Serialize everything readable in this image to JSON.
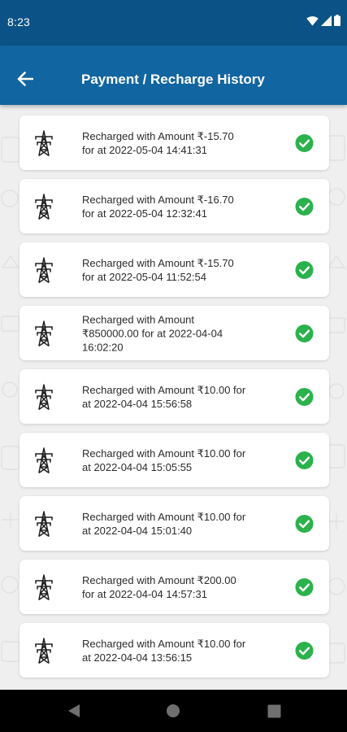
{
  "status_bar": {
    "time": "8:23",
    "icons": [
      "wifi-icon",
      "signal-icon",
      "battery-icon"
    ]
  },
  "app_bar": {
    "title": "Payment / Recharge History",
    "back_icon": "arrow-left-icon"
  },
  "history": [
    {
      "line1": "Recharged with Amount ₹-15.70",
      "line2": "for  at 2022-05-04 14:41:31",
      "line3": "",
      "status_icon": "check-circle-icon"
    },
    {
      "line1": "Recharged with Amount ₹-16.70",
      "line2": "for  at 2022-05-04 12:32:41",
      "line3": "",
      "status_icon": "check-circle-icon"
    },
    {
      "line1": "Recharged with Amount ₹-15.70",
      "line2": "for  at 2022-05-04 11:52:54",
      "line3": "",
      "status_icon": "check-circle-icon"
    },
    {
      "line1": "Recharged with Amount",
      "line2": "₹850000.00 for  at 2022-04-04",
      "line3": "16:02:20",
      "status_icon": "check-circle-icon"
    },
    {
      "line1": "Recharged with Amount ₹10.00 for",
      "line2": "at 2022-04-04 15:56:58",
      "line3": "",
      "status_icon": "check-circle-icon"
    },
    {
      "line1": "Recharged with Amount ₹10.00 for",
      "line2": "at 2022-04-04 15:05:55",
      "line3": "",
      "status_icon": "check-circle-icon"
    },
    {
      "line1": "Recharged with Amount ₹10.00 for",
      "line2": "at 2022-04-04 15:01:40",
      "line3": "",
      "status_icon": "check-circle-icon"
    },
    {
      "line1": "Recharged with Amount ₹200.00",
      "line2": "for  at 2022-04-04 14:57:31",
      "line3": "",
      "status_icon": "check-circle-icon"
    },
    {
      "line1": "Recharged with Amount ₹10.00 for",
      "line2": "at 2022-04-04 13:56:15",
      "line3": "",
      "status_icon": "check-circle-icon"
    }
  ],
  "nav_bar": {
    "buttons": [
      "back-triangle-icon",
      "home-circle-icon",
      "recents-square-icon"
    ]
  },
  "colors": {
    "status_bar": "#0b5387",
    "app_bar": "#1165a0",
    "background": "#efefef",
    "card": "#ffffff",
    "check": "#2bb24c",
    "text": "#2b2b2b",
    "nav_bar": "#000000"
  }
}
